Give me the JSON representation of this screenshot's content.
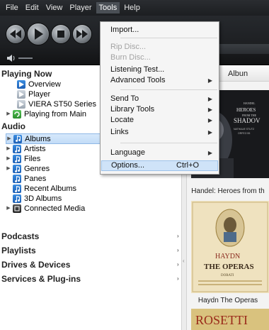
{
  "menubar": {
    "items": [
      {
        "label": "File"
      },
      {
        "label": "Edit"
      },
      {
        "label": "View"
      },
      {
        "label": "Player"
      },
      {
        "label": "Tools"
      },
      {
        "label": "Help"
      }
    ]
  },
  "transport": {
    "buttons": [
      "previous-icon",
      "play-icon",
      "stop-icon",
      "next-icon"
    ],
    "volume_icon": "speaker-icon"
  },
  "tools_menu": {
    "items": [
      {
        "label": "Import...",
        "state": "normal"
      },
      {
        "label": "Rip Disc...",
        "state": "disabled"
      },
      {
        "label": "Burn Disc...",
        "state": "disabled"
      },
      {
        "label": "Listening Test...",
        "state": "normal"
      },
      {
        "label": "Advanced Tools",
        "state": "submenu"
      },
      {
        "label": "Send To",
        "state": "submenu"
      },
      {
        "label": "Library Tools",
        "state": "submenu"
      },
      {
        "label": "Locate",
        "state": "submenu"
      },
      {
        "label": "Links",
        "state": "submenu"
      },
      {
        "label": "Language",
        "state": "submenu"
      },
      {
        "label": "Options...",
        "state": "highlighted",
        "shortcut": "Ctrl+O"
      }
    ]
  },
  "tree": {
    "playing_now": "Playing Now",
    "overview": "Overview",
    "player": "Player",
    "viera": "VIERA ST50 Series",
    "playing_from_main": "Playing from Main",
    "audio": "Audio",
    "albums": "Albums",
    "artists": "Artists",
    "files": "Files",
    "genres": "Genres",
    "panes": "Panes",
    "recent_albums": "Recent Albums",
    "albums_3d": "3D Albums",
    "connected_media": "Connected Media",
    "podcasts": "Podcasts",
    "playlists": "Playlists",
    "drives_devices": "Drives & Devices",
    "services_plugins": "Services & Plug-ins"
  },
  "content": {
    "column_header": "Albun",
    "album1": {
      "caption": "Handel: Heroes from th",
      "art_line1": "HANDEL",
      "art_line2": "HEROES",
      "art_line3": "FROM THE",
      "art_line4": "SHADOV",
      "art_line5": "NATHALIE STUTZ",
      "art_line6": "ORFEO 55"
    },
    "album2": {
      "caption": "Haydn The Operas",
      "art_line1": "HAYDN",
      "art_line2": "THE OPERAS",
      "art_line3": "DORATI"
    },
    "album3": {
      "art_line1": "ROSETTI"
    }
  },
  "colors": {
    "accent_blue": "#1d5fb5",
    "selection": "#cfe3f8",
    "chrome_dark": "#1c1e21"
  }
}
